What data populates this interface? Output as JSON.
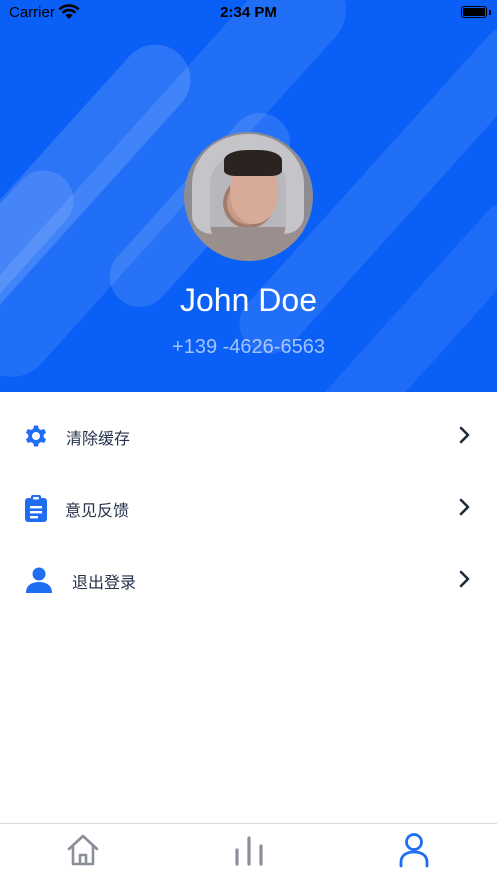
{
  "status_bar": {
    "carrier": "Carrier",
    "time": "2:34 PM",
    "icons": [
      "wifi-icon",
      "battery-icon"
    ]
  },
  "profile": {
    "name": "John Doe",
    "phone": "+139 -4626-6563",
    "avatar_icon": "user-photo"
  },
  "menu": {
    "items": [
      {
        "label": "清除缓存",
        "icon": "gear-icon"
      },
      {
        "label": "意见反馈",
        "icon": "clipboard-icon"
      },
      {
        "label": "退出登录",
        "icon": "person-icon"
      }
    ]
  },
  "tab_bar": {
    "tabs": [
      {
        "icon": "home-icon",
        "active": false
      },
      {
        "icon": "chart-icon",
        "active": false
      },
      {
        "icon": "profile-icon",
        "active": true
      }
    ]
  },
  "colors": {
    "header_blue": "#0a5ff6",
    "icon_blue": "#1f6ef2",
    "label_text": "#26324a",
    "chevron": "#1f2a3d",
    "tab_inactive": "#8a8f99",
    "tab_active": "#1f6ef2"
  }
}
